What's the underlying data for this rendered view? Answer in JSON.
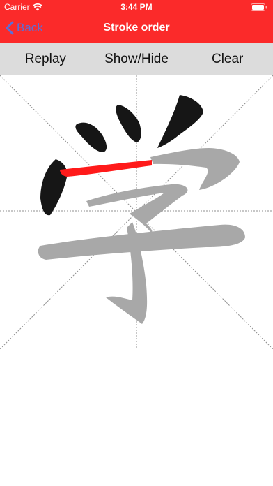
{
  "status_bar": {
    "carrier": "Carrier",
    "time": "3:44 PM",
    "wifi_icon": "wifi-icon",
    "battery_icon": "battery-icon"
  },
  "nav": {
    "back_label": "Back",
    "back_icon": "chevron-left-icon",
    "title": "Stroke order"
  },
  "toolbar": {
    "replay_label": "Replay",
    "show_hide_label": "Show/Hide",
    "clear_label": "Clear"
  },
  "canvas": {
    "character": "学",
    "total_strokes": 8,
    "completed_strokes": 3,
    "animating_stroke": 4,
    "guide_lines": [
      "diagonal",
      "center-cross"
    ]
  },
  "colors": {
    "header_red": "#fb2a2a",
    "back_blue": "#5b6fd9",
    "toolbar_gray": "#dcdcdc",
    "stroke_done": "#161616",
    "stroke_active": "#ff1a1a",
    "stroke_pending": "#a8a8a8",
    "guide_line": "#8f8f8f"
  }
}
